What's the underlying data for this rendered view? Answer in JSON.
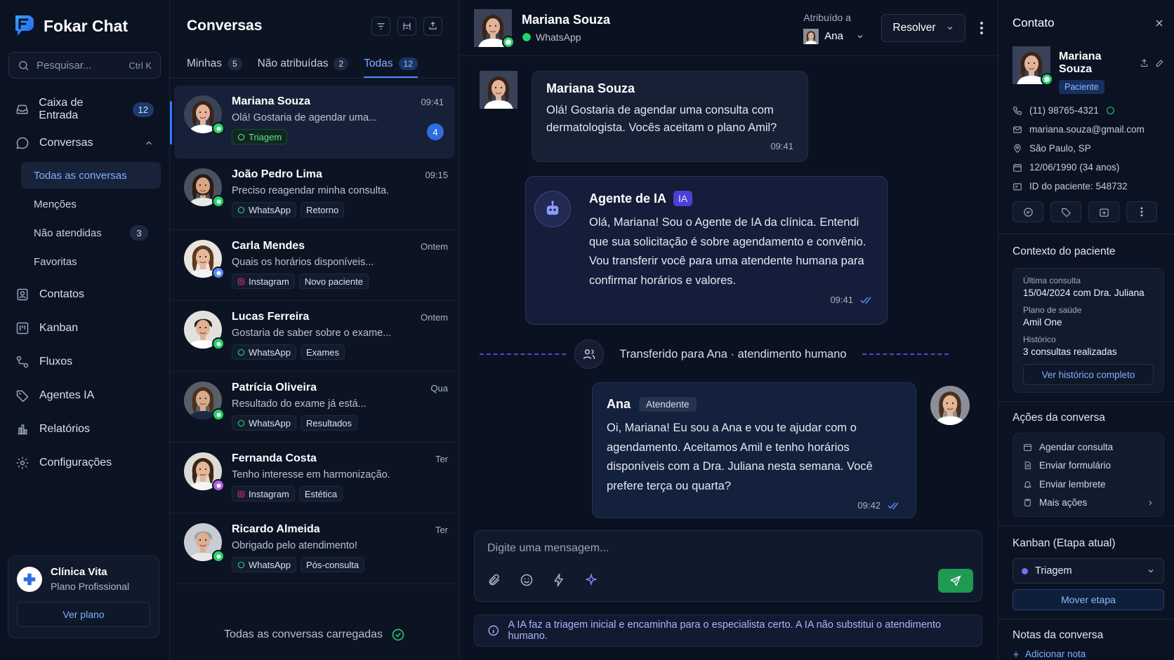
{
  "brand": {
    "name": "Fokar Chat"
  },
  "search": {
    "placeholder": "Pesquisar...",
    "shortcut": "Ctrl K"
  },
  "nav": {
    "inbox": {
      "label": "Caixa de Entrada",
      "count": "12"
    },
    "conversations": {
      "label": "Conversas"
    },
    "sub": [
      {
        "label": "Todas as conversas"
      },
      {
        "label": "Menções"
      },
      {
        "label": "Não atendidas",
        "count": "3"
      },
      {
        "label": "Favoritas"
      }
    ],
    "items": [
      {
        "label": "Contatos",
        "icon": "contacts-icon"
      },
      {
        "label": "Kanban",
        "icon": "kanban-icon"
      },
      {
        "label": "Fluxos",
        "icon": "flows-icon"
      },
      {
        "label": "Agentes IA",
        "icon": "tag-icon"
      },
      {
        "label": "Relatórios",
        "icon": "reports-icon"
      },
      {
        "label": "Configurações",
        "icon": "gear-icon"
      }
    ]
  },
  "plan": {
    "name": "Clínica Vita",
    "tier": "Plano Profissional",
    "button": "Ver plano"
  },
  "list": {
    "title": "Conversas",
    "tabs": [
      {
        "label": "Minhas",
        "count": "5"
      },
      {
        "label": "Não atribuídas",
        "count": "2"
      },
      {
        "label": "Todas",
        "count": "12"
      }
    ],
    "footer": "Todas as conversas carregadas",
    "conversations": [
      {
        "name": "Mariana Souza",
        "time": "09:41",
        "preview": "Olá! Gostaria de agendar uma...",
        "tags": [
          "Triagem"
        ],
        "unread": "4",
        "channel": "whatsapp"
      },
      {
        "name": "João Pedro Lima",
        "time": "09:15",
        "preview": "Preciso reagendar minha consulta.",
        "tags": [
          "WhatsApp",
          "Retorno"
        ],
        "channel": "whatsapp"
      },
      {
        "name": "Carla Mendes",
        "time": "Ontem",
        "preview": "Quais os horários disponíveis...",
        "tags": [
          "Instagram",
          "Novo paciente"
        ],
        "channel": "web"
      },
      {
        "name": "Lucas Ferreira",
        "time": "Ontem",
        "preview": "Gostaria de saber sobre o exame...",
        "tags": [
          "WhatsApp",
          "Exames"
        ],
        "channel": "whatsapp"
      },
      {
        "name": "Patrícia Oliveira",
        "time": "Qua",
        "preview": "Resultado do exame já está...",
        "tags": [
          "WhatsApp",
          "Resultados"
        ],
        "channel": "whatsapp"
      },
      {
        "name": "Fernanda Costa",
        "time": "Ter",
        "preview": "Tenho interesse em harmonização.",
        "tags": [
          "Instagram",
          "Estética"
        ],
        "channel": "instagram"
      },
      {
        "name": "Ricardo Almeida",
        "time": "Ter",
        "preview": "Obrigado pelo atendimento!",
        "tags": [
          "WhatsApp",
          "Pós-consulta"
        ],
        "channel": "whatsapp"
      }
    ]
  },
  "chat": {
    "contact_name": "Mariana Souza",
    "channel": "WhatsApp",
    "assigned_label": "Atribuído a",
    "assigned_to": "Ana",
    "resolve": "Resolver",
    "messages": {
      "patient": {
        "name": "Mariana Souza",
        "text": "Olá! Gostaria de agendar uma consulta com dermatologista. Vocês aceitam o plano Amil?",
        "time": "09:41"
      },
      "ai": {
        "name": "Agente de IA",
        "badge": "IA",
        "text": "Olá, Mariana! Sou o Agente de IA da clínica. Entendi que sua solicitação é sobre agendamento e convênio. Vou transferir você para uma atendente humana para confirmar horários e valores.",
        "time": "09:41"
      },
      "transfer": "Transferido para Ana · atendimento humano",
      "agent": {
        "name": "Ana",
        "role": "Atendente",
        "text": "Oi, Mariana! Eu sou a Ana e vou te ajudar com o agendamento. Aceitamos Amil e tenho horários disponíveis com a Dra. Juliana nesta semana. Você prefere terça ou quarta?",
        "time": "09:42"
      }
    },
    "input_placeholder": "Digite uma mensagem...",
    "notice": "A IA faz a triagem inicial e encaminha para o especialista certo. A IA não substitui o atendimento humano."
  },
  "contact": {
    "title": "Contato",
    "name": "Mariana Souza",
    "badge": "Paciente",
    "phone": "(11) 98765-4321",
    "email": "mariana.souza@gmail.com",
    "city": "São Paulo, SP",
    "birth": "12/06/1990 (34 anos)",
    "patient_id": "ID do paciente: 548732",
    "context_title": "Contexto do paciente",
    "last_visit_label": "Última consulta",
    "last_visit": "15/04/2024 com Dra. Juliana",
    "plan_label": "Plano de saúde",
    "plan": "Amil One",
    "history_label": "Histórico",
    "history": "3 consultas realizadas",
    "history_button": "Ver histórico completo",
    "actions_title": "Ações da conversa",
    "actions": [
      "Agendar consulta",
      "Enviar formulário",
      "Enviar lembrete",
      "Mais ações"
    ],
    "kanban_title": "Kanban (Etapa atual)",
    "kanban_stage": "Triagem",
    "kanban_button": "Mover etapa",
    "notes_title": "Notas da conversa",
    "add_note": "Adicionar nota"
  },
  "colors": {
    "accent": "#2f7bff",
    "whatsapp": "#25d366",
    "ai": "#4b3fd6",
    "send": "#1e9a52"
  }
}
